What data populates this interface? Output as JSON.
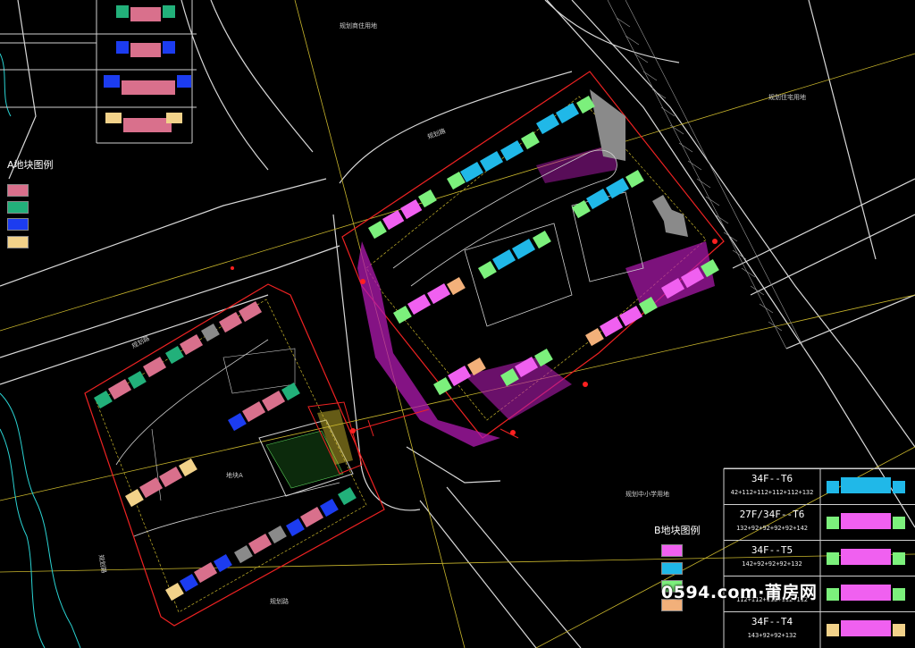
{
  "legend_a": {
    "title": "A地块图例",
    "swatches": [
      "#d9708c",
      "#22b07a",
      "#1c3cf0",
      "#f2d28a"
    ]
  },
  "legend_b": {
    "title": "B地块图例",
    "swatches": [
      "#f060f0",
      "#20b8e8",
      "#7cf07c",
      "#f2b07a"
    ]
  },
  "unit_table": {
    "rows": [
      {
        "title": "34F--T6",
        "sub": "42+112+112+112+112+132",
        "colors": [
          "#20b8e8",
          "#20b8e8"
        ]
      },
      {
        "title": "27F/34F--T6",
        "sub": "132+92+92+92+92+142",
        "colors": [
          "#f060f0",
          "#7cf07c"
        ]
      },
      {
        "title": "34F--T5",
        "sub": "142+92+92+92+132",
        "colors": [
          "#f060f0",
          "#7cf07c"
        ]
      },
      {
        "title": "",
        "sub": "112+112+112+112+112",
        "colors": [
          "#f060f0",
          "#7cf07c"
        ]
      },
      {
        "title": "34F--T4",
        "sub": "143+92+92+132",
        "colors": [
          "#f060f0",
          "#f2d28a"
        ]
      }
    ]
  },
  "site_labels": {
    "plot_a": "地块A",
    "north_commercial": "规划商住用地",
    "east_commercial": "规划住宅用地",
    "south_school": "规划中小学用地",
    "road_a": "规划路",
    "road_b": "规划路",
    "road_c": "规划路",
    "road_d": "规划路"
  },
  "watermark": "0594.com·莆房网"
}
